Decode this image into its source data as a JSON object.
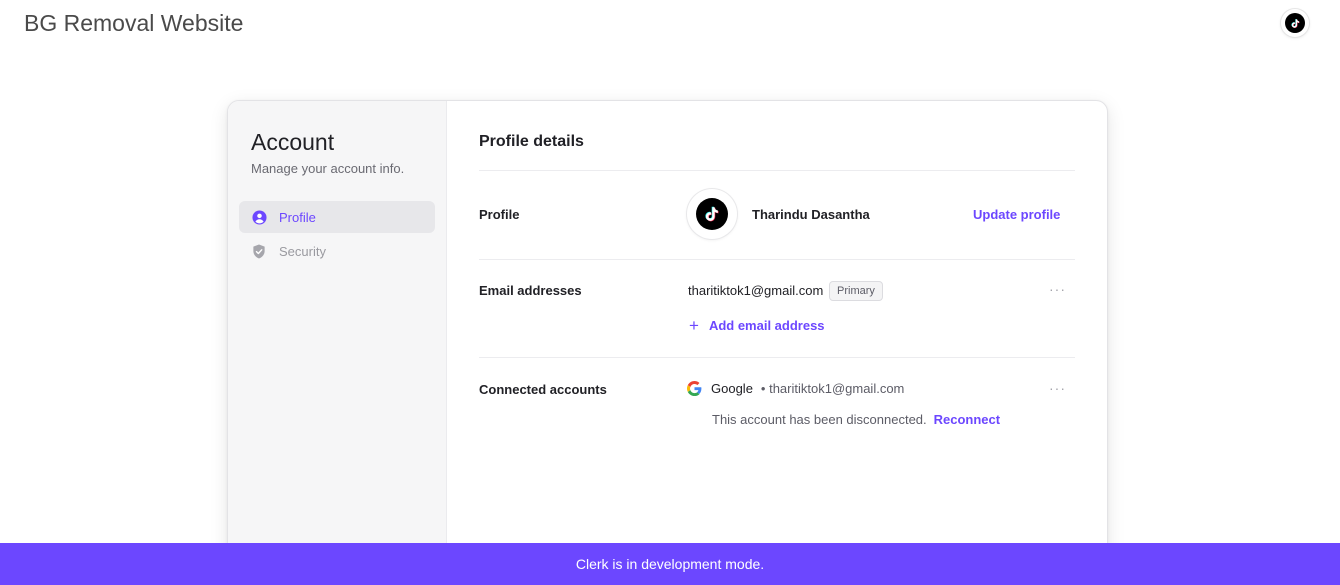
{
  "site": {
    "title": "BG Removal Website"
  },
  "colors": {
    "accent": "#6c47ff",
    "banner": "#6c47ff"
  },
  "sidebar": {
    "title": "Account",
    "subtitle": "Manage your account info.",
    "items": [
      {
        "label": "Profile",
        "icon": "user-circle-icon",
        "active": true
      },
      {
        "label": "Security",
        "icon": "shield-check-icon",
        "active": false
      }
    ]
  },
  "main": {
    "title": "Profile details",
    "profile": {
      "label": "Profile",
      "name": "Tharindu Dasantha",
      "avatar_icon": "tiktok-logo-icon",
      "update_label": "Update profile"
    },
    "emails": {
      "label": "Email addresses",
      "items": [
        {
          "address": "tharitiktok1@gmail.com",
          "badge": "Primary"
        }
      ],
      "add_label": "Add email address",
      "more_label": "···"
    },
    "connected": {
      "label": "Connected accounts",
      "items": [
        {
          "provider": "Google",
          "email": "• tharitiktok1@gmail.com",
          "icon": "google-icon",
          "status": "This account has been disconnected.",
          "action": "Reconnect"
        }
      ],
      "more_label": "···"
    }
  },
  "banner": {
    "text": "Clerk is in development mode."
  }
}
